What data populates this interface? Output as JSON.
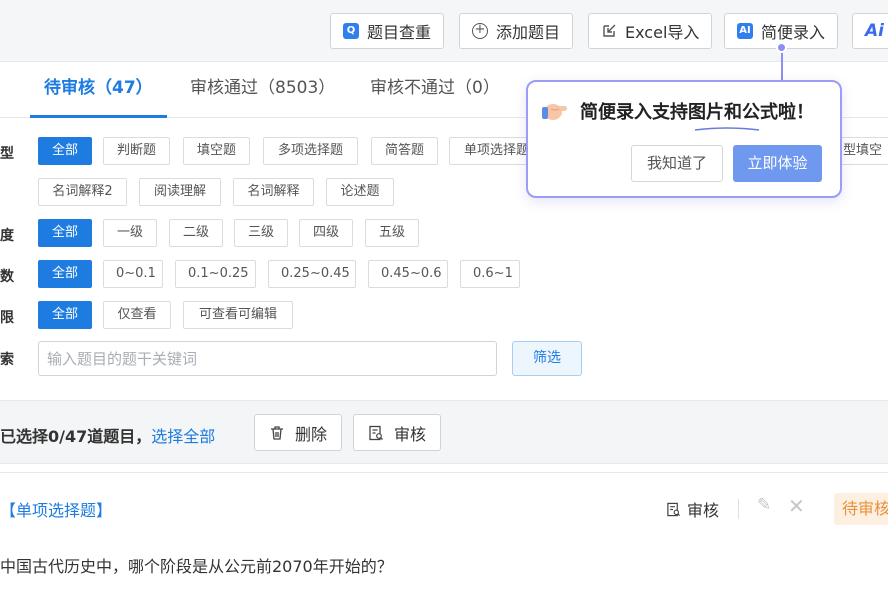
{
  "toolbar": {
    "dup_check": "题目查重",
    "add_question": "添加题目",
    "excel_import": "Excel导入",
    "simple_entry": "简便录入",
    "ai_logo": "Ai"
  },
  "tabs": [
    {
      "label": "待审核（47）"
    },
    {
      "label": "审核通过（8503）"
    },
    {
      "label": "审核不通过（0）"
    }
  ],
  "filters": {
    "type": {
      "label": "型",
      "options": [
        "全部",
        "判断题",
        "填空题",
        "多项选择题",
        "简答题",
        "单项选择题",
        "型填空",
        "名词解释2",
        "阅读理解",
        "名词解释",
        "论述题"
      ]
    },
    "difficulty": {
      "label": "度",
      "options": [
        "全部",
        "一级",
        "二级",
        "三级",
        "四级",
        "五级"
      ]
    },
    "coefficient": {
      "label": "数",
      "options": [
        "全部",
        "0~0.1",
        "0.1~0.25",
        "0.25~0.45",
        "0.45~0.6",
        "0.6~1"
      ]
    },
    "permission": {
      "label": "限",
      "options": [
        "全部",
        "仅查看",
        "可查看可编辑"
      ]
    },
    "search": {
      "label": "索",
      "placeholder": "输入题目的题干关键词",
      "button": "筛选"
    }
  },
  "selection": {
    "text": "已选择0/47道题目，",
    "select_all": "选择全部",
    "delete": "删除",
    "audit": "审核"
  },
  "question": {
    "type": "【单项选择题】",
    "audit": "审核",
    "status": "待审核",
    "text": "中国古代历史中，哪个阶段是从公元前2070年开始的？"
  },
  "popup": {
    "title": "简便录入支持图片和公式啦！",
    "dismiss": "我知道了",
    "try_now": "立即体验"
  },
  "colors": {
    "primary": "#1e7be0",
    "popup_border": "#9c9cf5",
    "status": "#e8923a"
  }
}
